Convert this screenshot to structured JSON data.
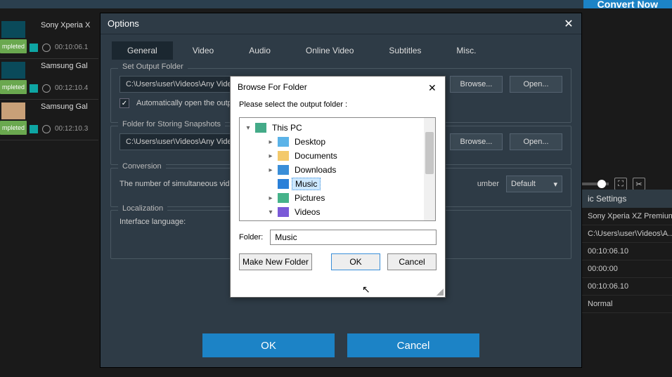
{
  "top": {
    "convert": "Convert Now"
  },
  "videos": [
    {
      "title": "Sony Xperia X",
      "badge": "mpleted",
      "time": "00:10:06.1"
    },
    {
      "title": "Samsung Gal",
      "badge": "mpleted",
      "time": "00:12:10.4"
    },
    {
      "title": "Samsung Gal",
      "badge": "mpleted",
      "time": "00:12:10.3"
    }
  ],
  "right": {
    "header": "ic Settings",
    "rows": [
      "Sony Xperia XZ Premium",
      "C:\\Users\\user\\Videos\\A...",
      "00:10:06.10",
      "00:00:00",
      "00:10:06.10",
      "Normal"
    ]
  },
  "options": {
    "title": "Options",
    "tabs": [
      "General",
      "Video",
      "Audio",
      "Online Video",
      "Subtitles",
      "Misc."
    ],
    "output_folder": {
      "title": "Set Output Folder",
      "path": "C:\\Users\\user\\Videos\\Any Video",
      "auto_open": "Automatically open the outp",
      "browse": "Browse...",
      "open": "Open..."
    },
    "snapshot_folder": {
      "title": "Folder for Storing Snapshots",
      "path": "C:\\Users\\user\\Videos\\Any Video",
      "browse": "Browse...",
      "open": "Open..."
    },
    "conversion": {
      "title": "Conversion",
      "label": "The number of simultaneous vid",
      "num_label": "umber",
      "default": "Default"
    },
    "localization": {
      "title": "Localization",
      "label": "Interface language:"
    },
    "ok": "OK",
    "cancel": "Cancel"
  },
  "browse": {
    "title": "Browse For Folder",
    "instr": "Please select the output folder :",
    "tree": [
      {
        "label": "This PC",
        "icon": "ic-pc",
        "exp": "▾",
        "indent": 0
      },
      {
        "label": "Desktop",
        "icon": "ic-desktop",
        "exp": "▸",
        "indent": 2
      },
      {
        "label": "Documents",
        "icon": "ic-folder",
        "exp": "▸",
        "indent": 2
      },
      {
        "label": "Downloads",
        "icon": "ic-down",
        "exp": "▸",
        "indent": 2
      },
      {
        "label": "Music",
        "icon": "ic-music",
        "exp": "",
        "indent": 2,
        "selected": true
      },
      {
        "label": "Pictures",
        "icon": "ic-pic",
        "exp": "▸",
        "indent": 2
      },
      {
        "label": "Videos",
        "icon": "ic-vid",
        "exp": "▾",
        "indent": 2
      }
    ],
    "folder_label": "Folder:",
    "folder_value": "Music",
    "make_new": "Make New Folder",
    "ok": "OK",
    "cancel": "Cancel"
  }
}
